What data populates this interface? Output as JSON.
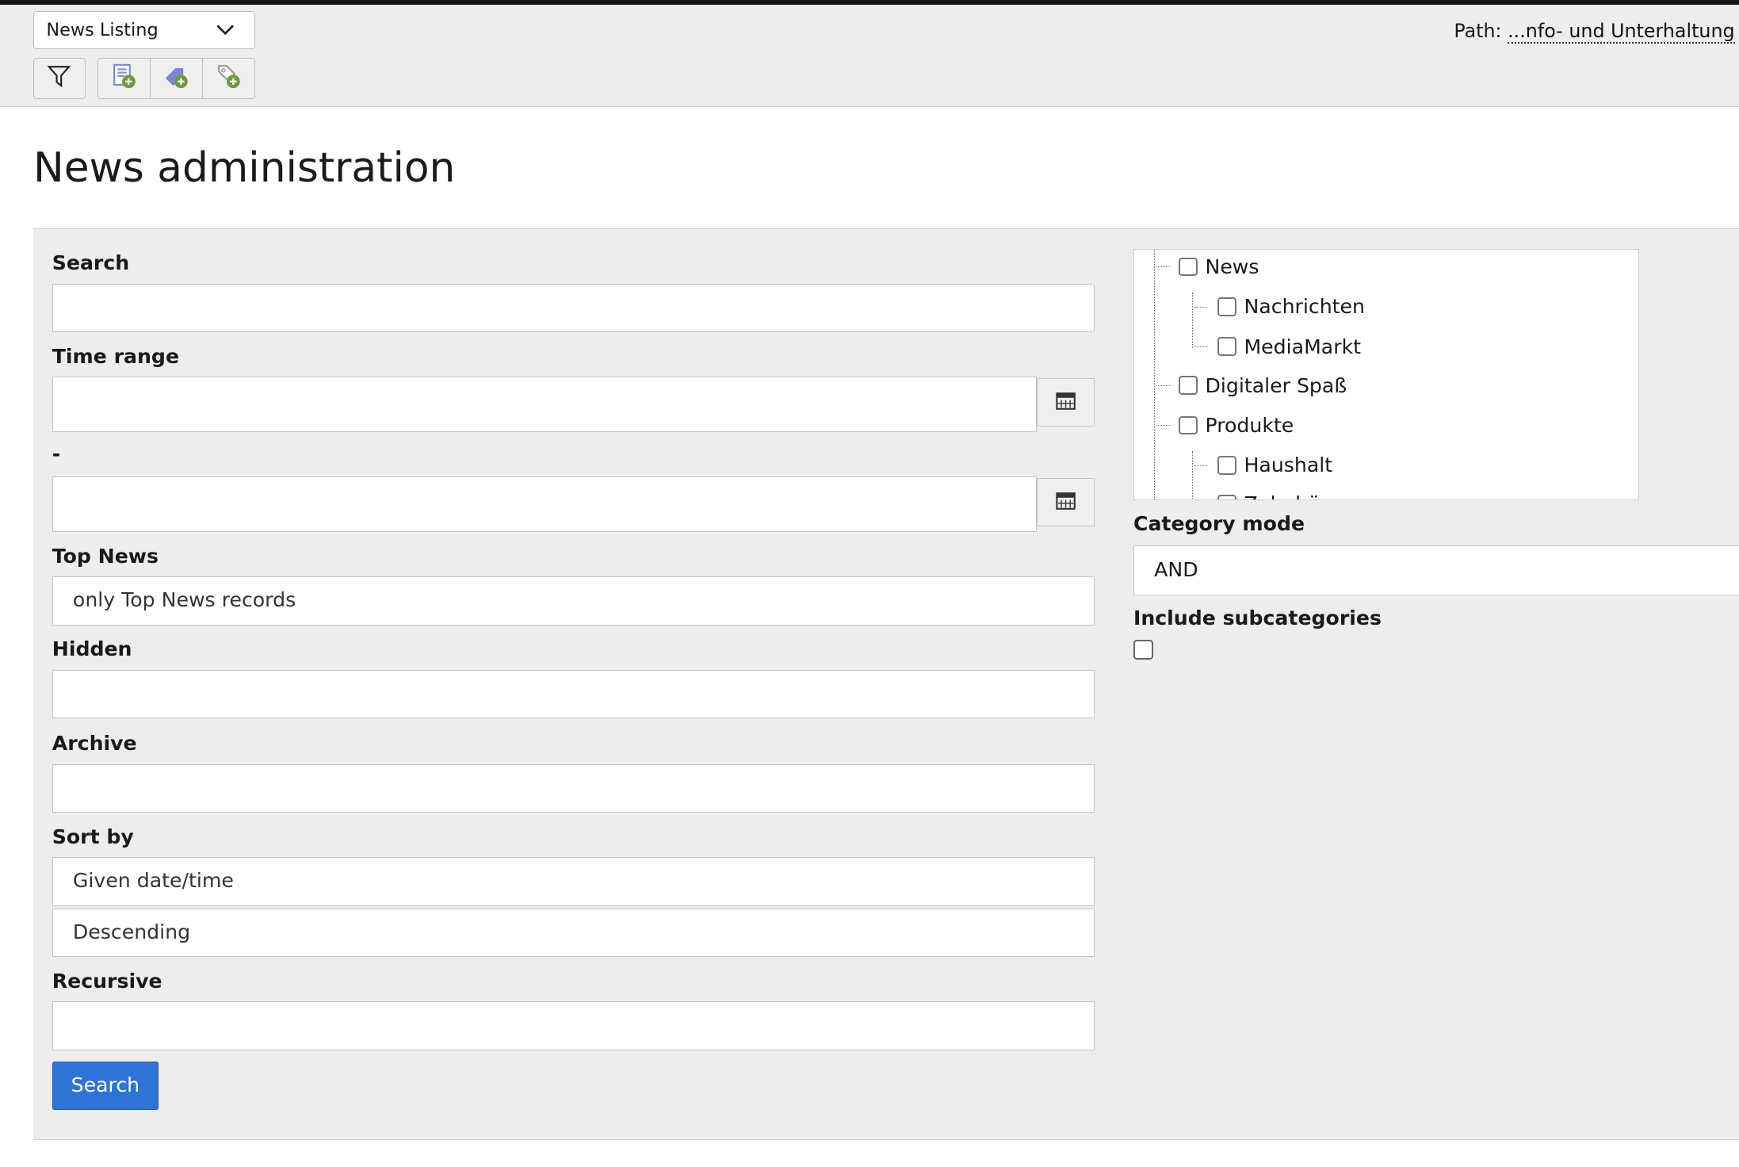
{
  "header": {
    "module_select": "News Listing",
    "toolbar": [
      "filter-icon",
      "new-news-record-icon",
      "new-category-icon",
      "new-tag-icon"
    ],
    "path_label": "Path:",
    "path_value": "...nfo- und Unterhaltung"
  },
  "page_title": "News administration",
  "form": {
    "search_label": "Search",
    "search_value": "",
    "time_range_label": "Time range",
    "time_from": "",
    "separator_label": "-",
    "time_to": "",
    "top_news_label": "Top News",
    "top_news_value": "only Top News records",
    "hidden_label": "Hidden",
    "hidden_value": "",
    "archive_label": "Archive",
    "archive_value": "",
    "sort_by_label": "Sort by",
    "sort_field": "Given date/time",
    "sort_direction": "Descending",
    "recursive_label": "Recursive",
    "recursive_value": "",
    "search_button": "Search"
  },
  "categories": {
    "tree": [
      {
        "label": "News",
        "checked": false
      },
      {
        "label": "Nachrichten",
        "checked": false
      },
      {
        "label": "MediaMarkt",
        "checked": false
      },
      {
        "label": "Digitaler Spaß",
        "checked": false
      },
      {
        "label": "Produkte",
        "checked": false
      },
      {
        "label": "Haushalt",
        "checked": false
      },
      {
        "label": "Zubehör",
        "checked": false
      }
    ],
    "mode_label": "Category mode",
    "mode_value": "AND",
    "include_sub_label": "Include subcategories",
    "include_sub_checked": false
  },
  "colors": {
    "primary_button": "#2e73d6",
    "icon_add": "#6f9a3c",
    "icon_doc": "#7b86d9"
  }
}
